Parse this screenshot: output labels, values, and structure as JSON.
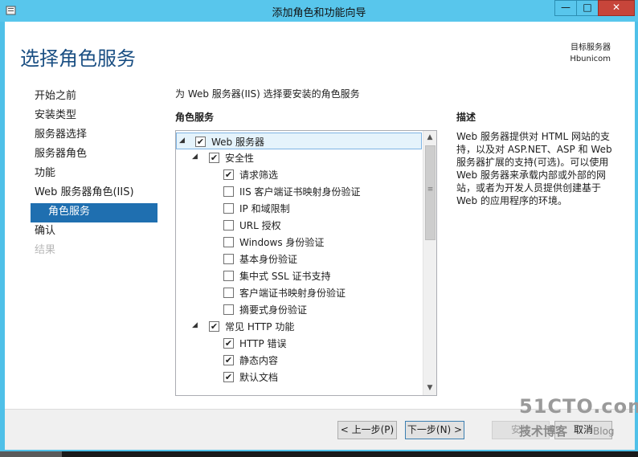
{
  "window": {
    "title": "添加角色和功能向导",
    "minimize_label": "—",
    "maximize_label": "□",
    "close_label": "✕"
  },
  "header": {
    "page_title": "选择角色服务",
    "target_label": "目标服务器",
    "target_server": "Hbunicom"
  },
  "nav": {
    "items": [
      {
        "label": "开始之前"
      },
      {
        "label": "安装类型"
      },
      {
        "label": "服务器选择"
      },
      {
        "label": "服务器角色"
      },
      {
        "label": "功能"
      },
      {
        "label": "Web 服务器角色(IIS)"
      },
      {
        "label": "角色服务"
      },
      {
        "label": "确认"
      },
      {
        "label": "结果"
      }
    ]
  },
  "main": {
    "instruction": "为 Web 服务器(IIS) 选择要安装的角色服务",
    "column_header": "角色服务"
  },
  "tree": {
    "rows": [
      {
        "label": "Web 服务器",
        "expander": "◢",
        "checked": "✔"
      },
      {
        "label": "安全性",
        "expander": "◢",
        "checked": "✔"
      },
      {
        "label": "请求筛选",
        "checked": "✔"
      },
      {
        "label": "IIS 客户端证书映射身份验证",
        "checked": ""
      },
      {
        "label": "IP 和域限制",
        "checked": ""
      },
      {
        "label": "URL 授权",
        "checked": ""
      },
      {
        "label": "Windows 身份验证",
        "checked": ""
      },
      {
        "label": "基本身份验证",
        "checked": ""
      },
      {
        "label": "集中式 SSL 证书支持",
        "checked": ""
      },
      {
        "label": "客户端证书映射身份验证",
        "checked": ""
      },
      {
        "label": "摘要式身份验证",
        "checked": ""
      },
      {
        "label": "常见 HTTP 功能",
        "expander": "◢",
        "checked": "✔"
      },
      {
        "label": "HTTP 错误",
        "checked": "✔"
      },
      {
        "label": "静态内容",
        "checked": "✔"
      },
      {
        "label": "默认文档",
        "checked": "✔"
      }
    ],
    "scroll_up": "▲",
    "scroll_down": "▼",
    "scroll_grip": "≡"
  },
  "description": {
    "heading": "描述",
    "text": "Web 服务器提供对 HTML 网站的支持，以及对 ASP.NET、ASP 和 Web 服务器扩展的支持(可选)。可以使用 Web 服务器来承载内部或外部的网站，或者为开发人员提供创建基于 Web 的应用程序的环境。"
  },
  "footer": {
    "prev_label": "< 上一步(P)",
    "next_label": "下一步(N) >",
    "install_label": "安装",
    "cancel_label": "取消"
  },
  "watermark": {
    "site": "51CTO.com",
    "tagline": "技术博客",
    "blog": "Blog"
  }
}
